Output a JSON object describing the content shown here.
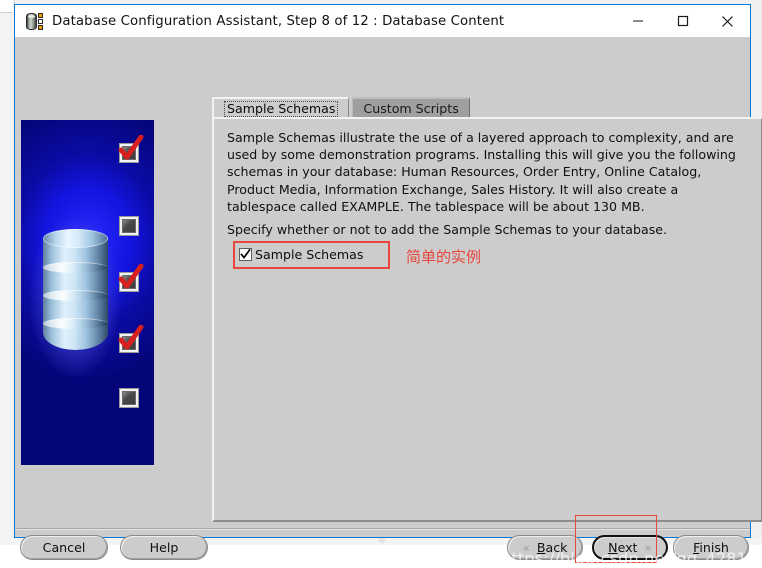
{
  "window": {
    "title": "Database Configuration Assistant, Step 8 of 12 : Database Content",
    "icon": "database-icon",
    "controls": {
      "minimize": "minimize-icon",
      "maximize": "maximize-icon",
      "close": "close-icon"
    },
    "accent_color": "#0078d7",
    "face_color": "#cccccc"
  },
  "illustration": {
    "name": "oracle-dbca-wizard-art",
    "background_color": "#0b0ba6",
    "graphic": "database-cylinder",
    "checkmarks": [
      {
        "state": "checked"
      },
      {
        "state": "unchecked"
      },
      {
        "state": "checked"
      },
      {
        "state": "checked"
      },
      {
        "state": "unchecked"
      }
    ]
  },
  "tabs": [
    {
      "label": "Sample Schemas",
      "active": true
    },
    {
      "label": "Custom Scripts",
      "active": false
    }
  ],
  "content": {
    "description": "Sample Schemas illustrate the use of a layered approach to complexity, and are used by some demonstration programs. Installing this will give you the following schemas in your database: Human Resources, Order Entry, Online Catalog, Product Media, Information Exchange, Sales History. It will also create a tablespace called EXAMPLE. The tablespace will be about 130 MB.",
    "specify": "Specify whether or not to add the Sample Schemas to your database.",
    "checkbox": {
      "label": "Sample Schemas",
      "checked": true
    }
  },
  "annotations": {
    "checkbox_note": "简单的实例",
    "color": "#e8453c"
  },
  "footer": {
    "cancel": "Cancel",
    "help": "Help",
    "back": "Back",
    "back_mnemonic": "B",
    "back_rest": "ack",
    "next": "Next",
    "next_mnemonic": "N",
    "next_rest": "ext",
    "finish": "Finish",
    "finish_mnemonic": "F",
    "finish_rest": "inish",
    "back_chevron": "«",
    "next_chevron": "»"
  },
  "watermark": "https://blog.csdn.net/qq_42816766"
}
